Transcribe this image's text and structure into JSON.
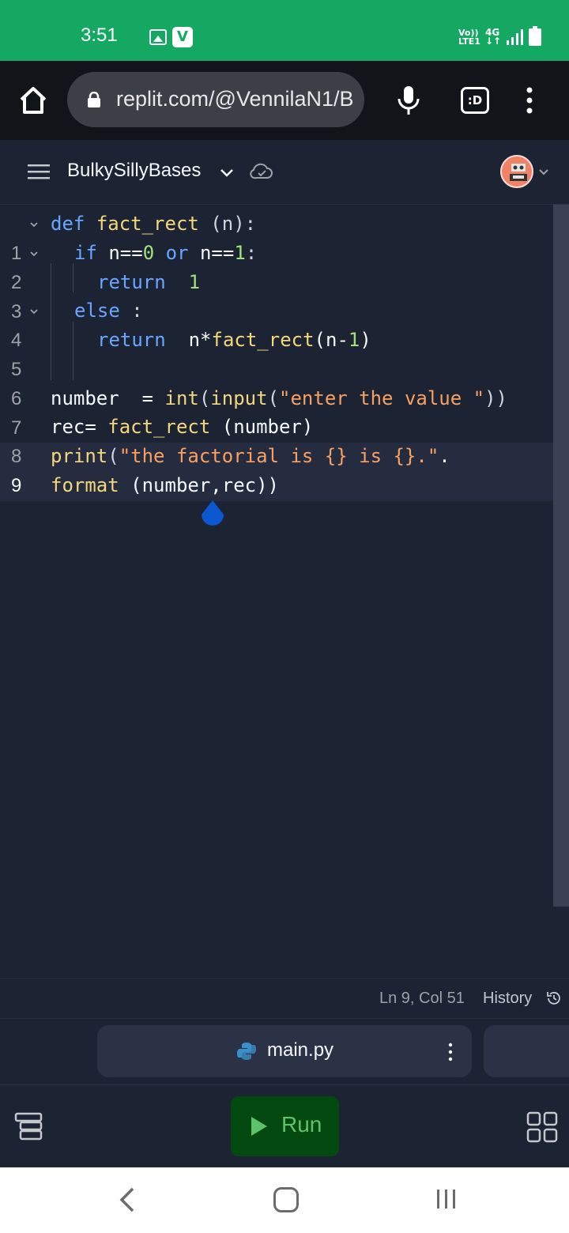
{
  "status_bar": {
    "time": "3:51",
    "volte_line1": "Vo))",
    "volte_line2": "LTE1",
    "network": "4G",
    "network_arrows": "↓↑"
  },
  "browser": {
    "url": "replit.com/@VennilaN1/B",
    "extension_label": ":D"
  },
  "header": {
    "repl_name": "BulkySillyBases"
  },
  "editor": {
    "line_numbers": [
      "1",
      "2",
      "3",
      "4",
      "5",
      "6",
      "7",
      "8",
      "9"
    ],
    "tokens": {
      "l1": {
        "kw": "def",
        "fn": "fact_rect",
        "rest": " (n):"
      },
      "l2": {
        "kw_if": "if",
        "a": " n==",
        "zero": "0",
        "kw_or": " or",
        "b": " n==",
        "one": "1",
        "c": ":"
      },
      "l3": {
        "kw": "return",
        "num": "1"
      },
      "l4": {
        "kw": "else",
        "rest": " :"
      },
      "l5": {
        "kw": "return",
        "a": "  n*",
        "fn": "fact_rect",
        "b": "(n-",
        "num": "1",
        "c": ")"
      },
      "l7": {
        "a": "number  = ",
        "fn1": "int",
        "b": "(",
        "fn2": "input",
        "c": "(",
        "str": "\"enter the value \"",
        "d": "))"
      },
      "l8": {
        "a": "rec= ",
        "fn": "fact_rect",
        "b": " (number)"
      },
      "l9": {
        "fn": "print",
        "a": "(",
        "str": "\"the factorial is {} is {}.\"",
        "dot": ".",
        "fn2": "format",
        "b": " (number,rec))"
      }
    }
  },
  "status_line": {
    "cursor_position": "Ln 9, Col 51",
    "history_label": "History"
  },
  "file_tabs": {
    "active_file": "main.py"
  },
  "toolbar": {
    "run_label": "Run"
  },
  "colors": {
    "status_bar": "#14a863",
    "editor_bg": "#1c2333",
    "keyword": "#69a6ff",
    "function": "#f2d77d",
    "number": "#a4e07d",
    "string": "#f8a061",
    "run_button_bg": "#044a10",
    "run_button_fg": "#5ec26a"
  }
}
